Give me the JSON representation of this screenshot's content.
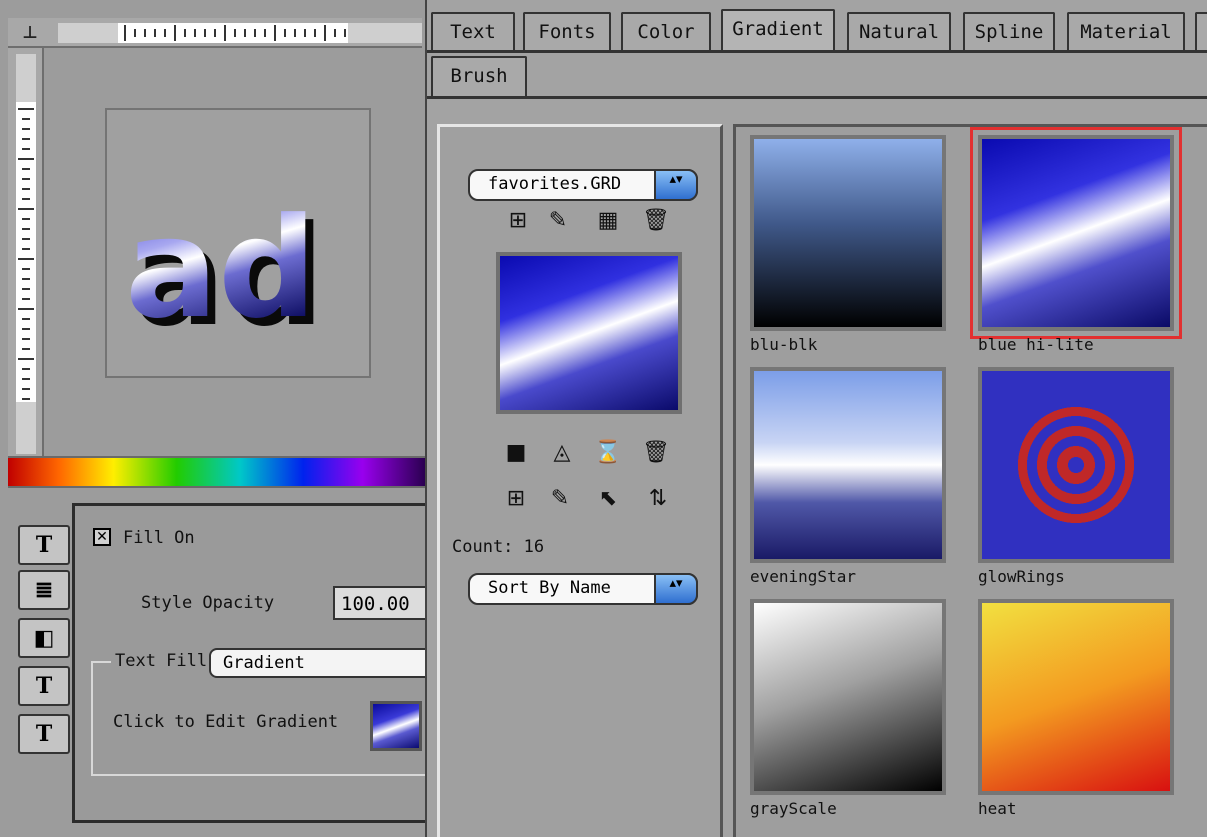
{
  "left": {
    "ruler_corner_glyph": "⊥",
    "canvas_preview_text": "ad",
    "fill_on_label": "Fill On",
    "fill_on_checked": true,
    "style_opacity_label": "Style Opacity",
    "style_opacity_value": "100.00",
    "text_fill_label": "Text Fill",
    "text_fill_value": "Gradient",
    "edit_gradient_label": "Click to Edit Gradient",
    "side_tabs": [
      "T",
      "≣",
      "◧",
      "T",
      "T"
    ]
  },
  "tabs": {
    "row1": [
      "Text",
      "Fonts",
      "Color",
      "Gradient",
      "Natural",
      "Spline",
      "Material"
    ],
    "row2": [
      "Brush"
    ],
    "active": "Gradient"
  },
  "gradient_controls": {
    "library_value": "favorites.GRD",
    "count_label": "Count: 16",
    "sort_value": "Sort By Name",
    "popup_arrow_glyph": "▴▾"
  },
  "gradients": [
    {
      "label": "blu-blk",
      "selected": false
    },
    {
      "label": "blue hi-lite",
      "selected": true
    },
    {
      "label": "eveningStar",
      "selected": false
    },
    {
      "label": "glowRings",
      "selected": false
    },
    {
      "label": "grayScale",
      "selected": false
    },
    {
      "label": "heat",
      "selected": false
    }
  ],
  "colors": {
    "selection_outline": "#e23030",
    "accent_blue": "#2f6fd0"
  }
}
